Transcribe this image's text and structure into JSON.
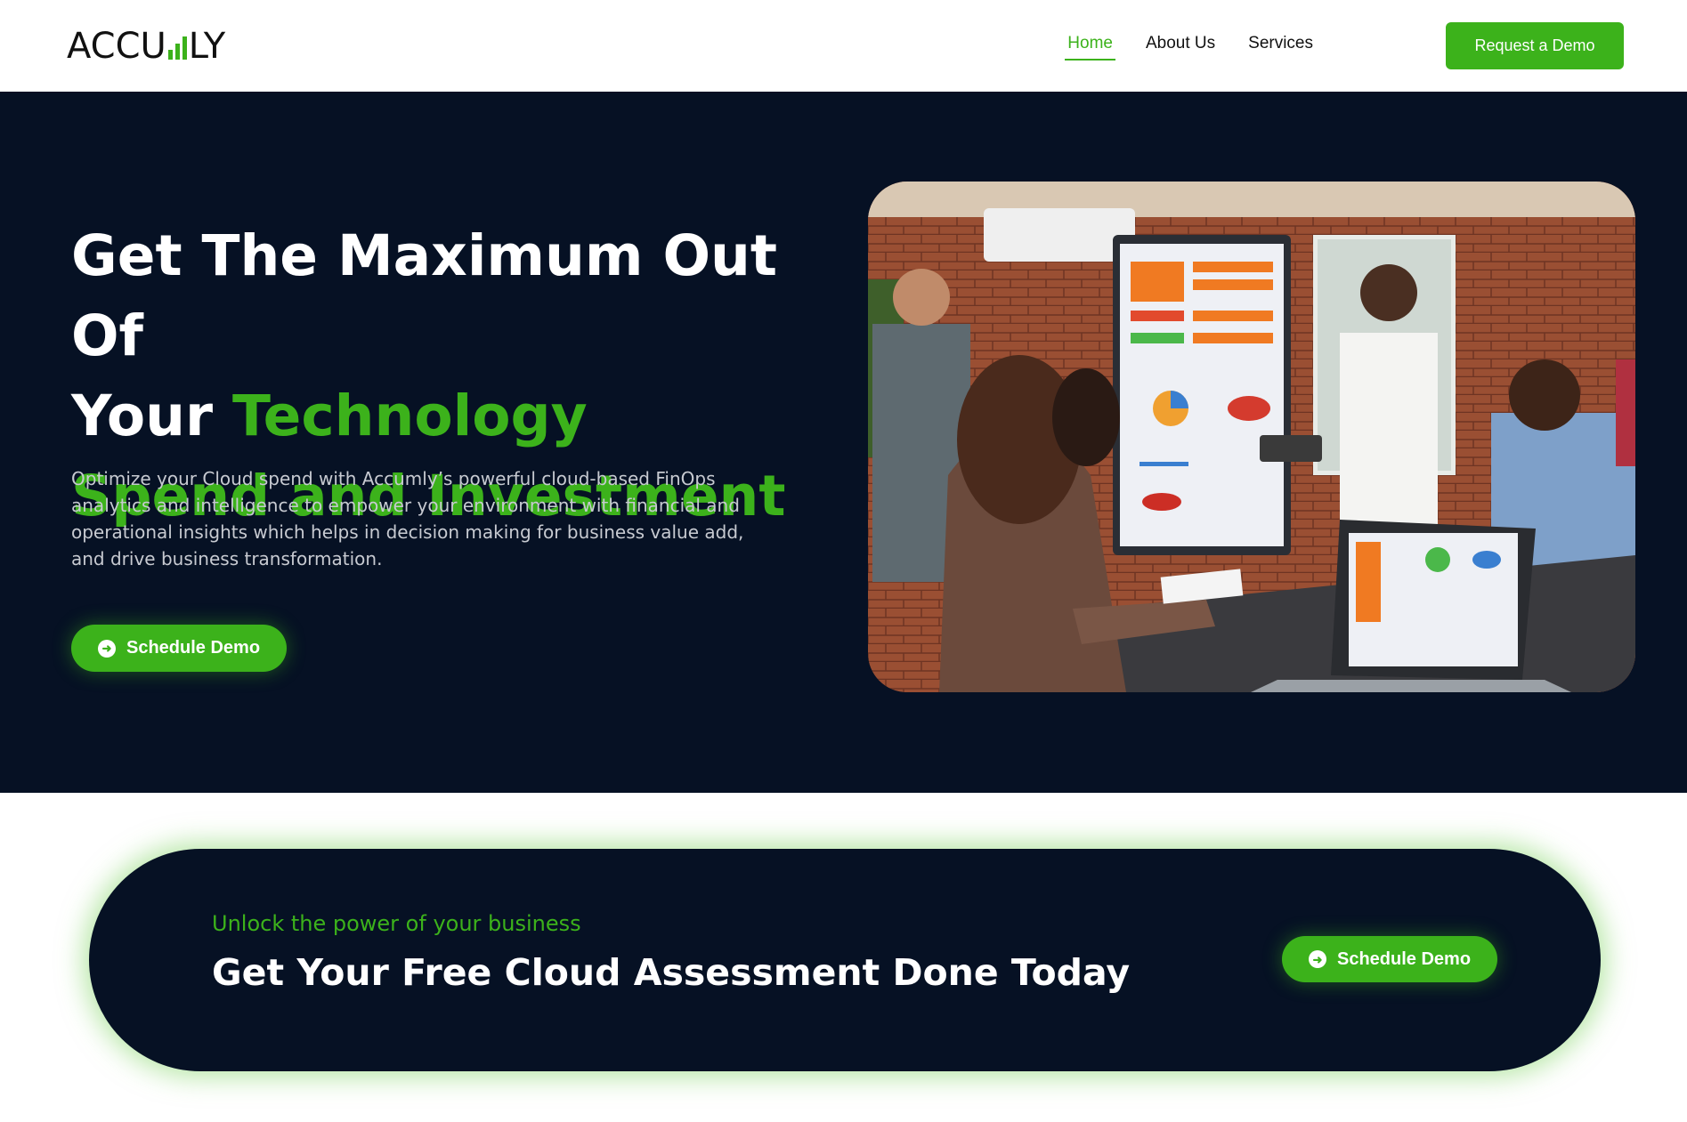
{
  "header": {
    "logo_text_start": "ACCU",
    "logo_text_end": "LY",
    "logo_full": "ACCUMLY",
    "nav": [
      {
        "label": "Home",
        "active": true
      },
      {
        "label": "About Us",
        "active": false
      },
      {
        "label": "Services",
        "active": false
      }
    ],
    "cta_label": "Request a Demo"
  },
  "hero": {
    "title_line1": "Get The Maximum Out Of",
    "title_line2_white": "Your ",
    "title_line2_green": "Technology",
    "title_line3": "Spend and Investment",
    "description": "Optimize your Cloud spend with Accumly’s powerful cloud-based FinOps analytics and intelligence to empower your environment with financial and operational insights which helps in decision making for business value add, and drive business transformation.",
    "button_label": "Schedule Demo"
  },
  "cta": {
    "kicker": "Unlock the power of your business",
    "title": "Get Your Free Cloud Assessment Done Today",
    "button_label": "Schedule Demo"
  },
  "colors": {
    "accent": "#3cb21b",
    "dark": "#061124"
  },
  "icons": {
    "arrow": "arrow-circle-right-icon"
  }
}
